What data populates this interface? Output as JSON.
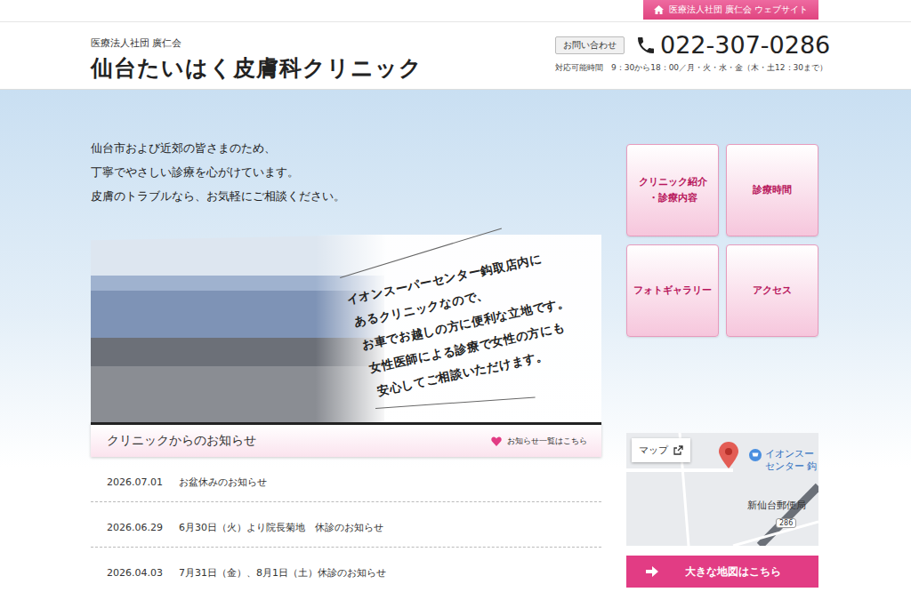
{
  "top_link": {
    "label": "医療法人社団 廣仁会 ウェブサイト"
  },
  "header": {
    "org": "医療法人社団 廣仁会",
    "title": "仙台たいはく皮膚科クリニック",
    "contact_label": "お問い合わせ",
    "phone": "022-307-0286",
    "hours": "対応可能時間　9：30から18：00／月・火・水・金（木・土12：30まで）"
  },
  "intro": [
    "仙台市および近郊の皆さまのため、",
    "丁寧でやさしい診療を心がけています。",
    "皮膚のトラブルなら、お気軽にご相談ください。"
  ],
  "photo_caption": [
    "イオンスーパーセンター鈎取店内に",
    "あるクリニックなので、",
    "お車でお越しの方に便利な立地です。",
    "女性医師による診療で女性の方にも",
    "安心してご相談いただけます。"
  ],
  "nav": [
    {
      "lines": [
        "クリニック紹介",
        "・診療内容"
      ]
    },
    {
      "lines": [
        "診療時間"
      ]
    },
    {
      "lines": [
        "フォトギャラリー"
      ]
    },
    {
      "lines": [
        "アクセス"
      ]
    }
  ],
  "news": {
    "title": "クリニックからのお知らせ",
    "more": "お知らせ一覧はこちら",
    "items": [
      {
        "date": "2026.07.01",
        "title": "お盆休みのお知らせ"
      },
      {
        "date": "2026.06.29",
        "title": "6月30日（火）より院長菊地　休診のお知らせ"
      },
      {
        "date": "2026.04.03",
        "title": "7月31日（金）、8月1日（土）休診のお知らせ"
      }
    ]
  },
  "map": {
    "button_label": "マップ",
    "place_line1": "イオンスー",
    "place_line2": "センター 鈎",
    "post_office": "新仙台郵便局",
    "road_number": "286"
  },
  "big_map_button": "大きな地図はこちら"
}
